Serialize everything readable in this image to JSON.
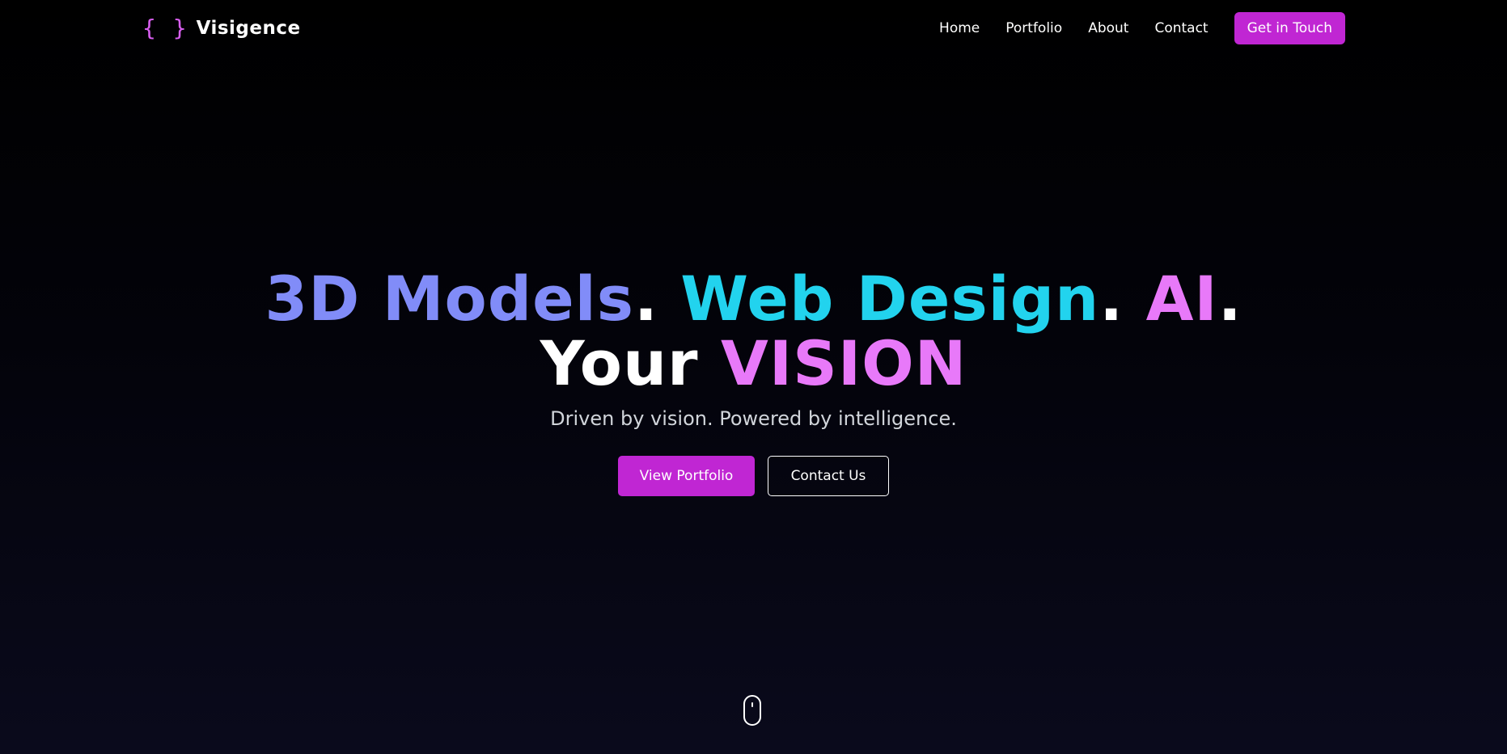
{
  "brand": {
    "logo_glyph": "{ }",
    "name": "Visigence",
    "accent_color": "#c026d3",
    "logo_color": "#d85ef0"
  },
  "nav": {
    "links": [
      "Home",
      "Portfolio",
      "About",
      "Contact"
    ],
    "cta_label": "Get in Touch"
  },
  "hero": {
    "line1": {
      "part1": "3D Models",
      "dot1": ".",
      "part2": "Web Design",
      "dot2": ".",
      "part3": "AI",
      "dot3": "."
    },
    "line2": {
      "part1": "Your",
      "part2": "VISION"
    },
    "subtitle": "Driven by vision. Powered by intelligence.",
    "primary_button": "View Portfolio",
    "secondary_button": "Contact Us",
    "colors": {
      "indigo": "#818cf8",
      "cyan": "#22d3ee",
      "pink": "#e879f9"
    }
  },
  "scroll_indicator": {
    "icon": "mouse-scroll-icon"
  }
}
